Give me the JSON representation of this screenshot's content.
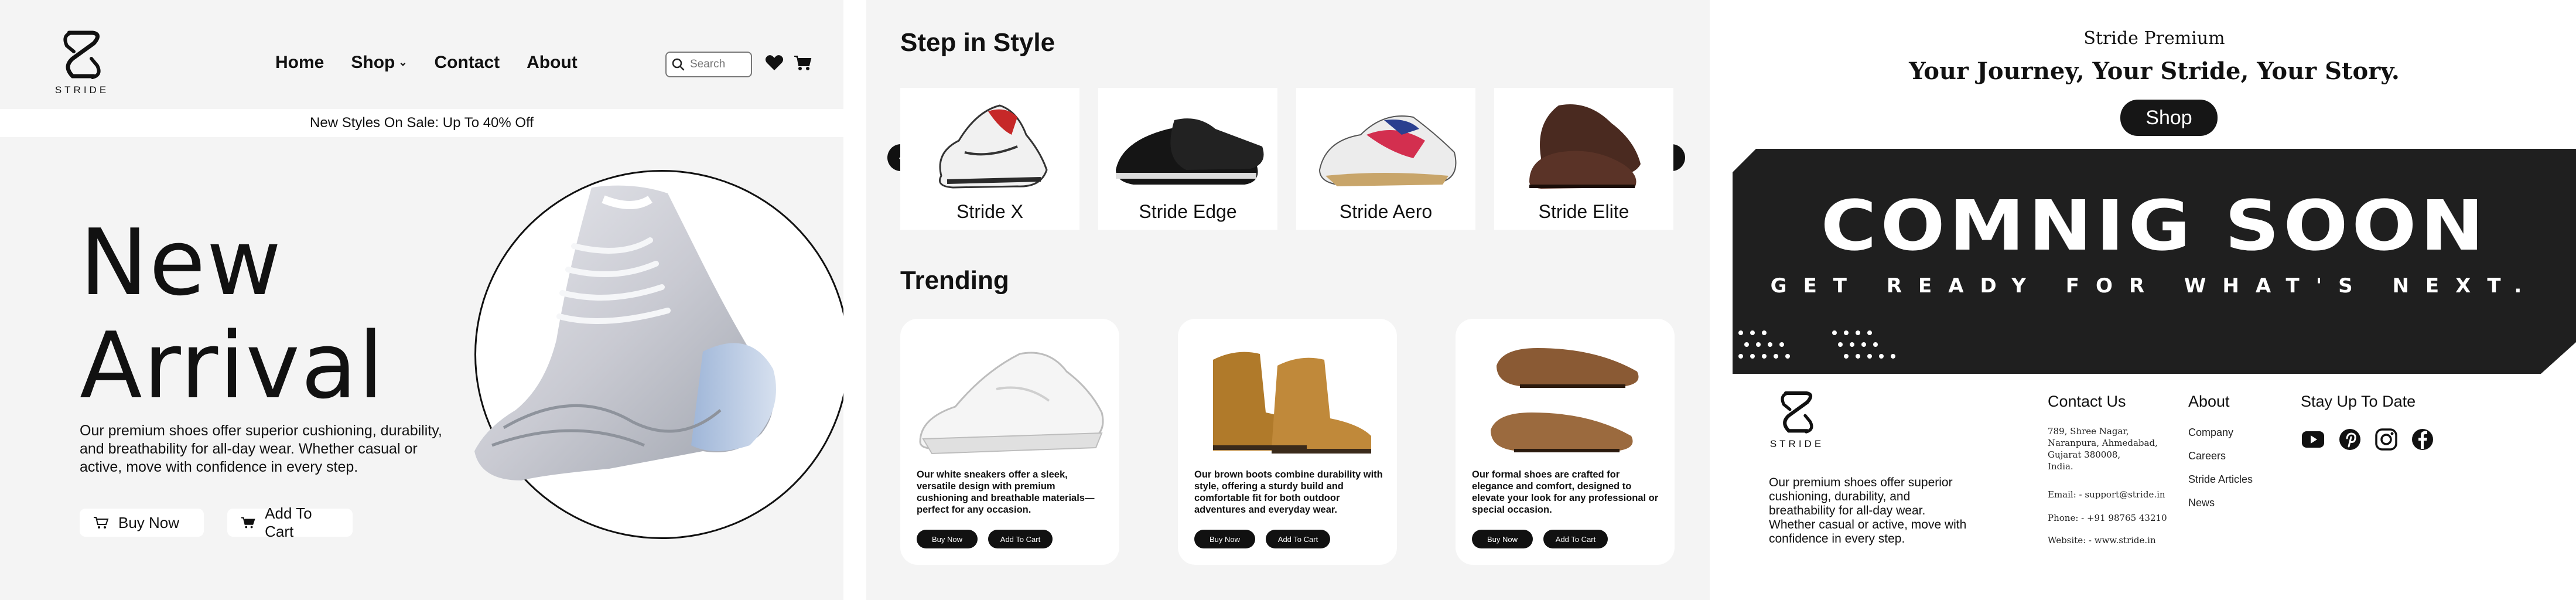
{
  "brand": {
    "logo_text": "STRIDE"
  },
  "nav": {
    "items": [
      "Home",
      "Shop",
      "Contact",
      "About"
    ],
    "search_placeholder": "Search"
  },
  "sale_bar": "New Styles On Sale: Up To 40% Off",
  "hero": {
    "title_line1": "New",
    "title_line2": "Arrival",
    "description": "Our premium shoes offer superior cushioning, durability, and breathability for all-day wear. Whether casual or active, move with confidence in every step.",
    "buy_now": "Buy Now",
    "add_to_cart": "Add To Cart"
  },
  "step_in_style": {
    "title": "Step in Style",
    "products": [
      "Stride X",
      "Stride Edge",
      "Stride Aero",
      "Stride Elite"
    ]
  },
  "trending": {
    "title": "Trending",
    "cards": [
      {
        "description": "Our white sneakers offer a sleek, versatile design with premium cushioning and breathable materials—perfect for any occasion.",
        "buy": "Buy Now",
        "cart": "Add To Cart"
      },
      {
        "description": "Our brown boots combine durability with style, offering a sturdy build and comfortable fit for both outdoor adventures and everyday wear.",
        "buy": "Buy Now",
        "cart": "Add To Cart"
      },
      {
        "description": "Our formal shoes are crafted for elegance and comfort, designed to elevate your look for any professional or special occasion.",
        "buy": "Buy Now",
        "cart": "Add To Cart"
      }
    ]
  },
  "premium": {
    "subtitle": "Stride Premium",
    "title": "Your Journey, Your Stride, Your Story.",
    "shop_label": "Shop"
  },
  "banner": {
    "title": "COMNIG SOON",
    "subtitle": "GET READY FOR WHAT'S NEXT."
  },
  "footer": {
    "description": "Our premium shoes offer superior cushioning, durability, and breathability for all-day wear. Whether casual or active, move with confidence in every step.",
    "contact_heading": "Contact Us",
    "address_lines": [
      "789, Shree Nagar,",
      "Naranpura, Ahmedabad,",
      "Gujarat 380008,",
      "India."
    ],
    "email": "Email: - support@stride.in",
    "phone": "Phone: - +91 98765 43210",
    "website": "Website: - www.stride.in",
    "about_heading": "About",
    "about_links": [
      "Company",
      "Careers",
      "Stride Articles",
      "News"
    ],
    "updates_heading": "Stay Up To Date",
    "social_icons": [
      "youtube-icon",
      "pinterest-icon",
      "instagram-icon",
      "facebook-icon"
    ]
  }
}
